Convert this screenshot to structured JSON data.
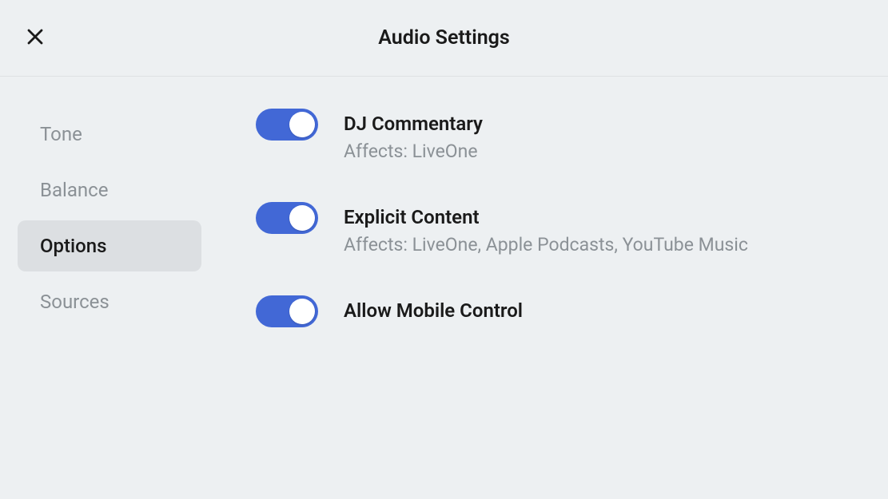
{
  "header": {
    "title": "Audio Settings"
  },
  "sidebar": {
    "items": [
      {
        "label": "Tone",
        "active": false
      },
      {
        "label": "Balance",
        "active": false
      },
      {
        "label": "Options",
        "active": true
      },
      {
        "label": "Sources",
        "active": false
      }
    ]
  },
  "options": [
    {
      "label": "DJ Commentary",
      "sub": "Affects: LiveOne",
      "on": true
    },
    {
      "label": "Explicit Content",
      "sub": "Affects: LiveOne, Apple Podcasts, YouTube Music",
      "on": true
    },
    {
      "label": "Allow Mobile Control",
      "sub": "",
      "on": true
    }
  ],
  "colors": {
    "accent": "#4268d6",
    "bg": "#edf0f2",
    "text": "#1a1a1a",
    "muted": "#8b9196"
  }
}
